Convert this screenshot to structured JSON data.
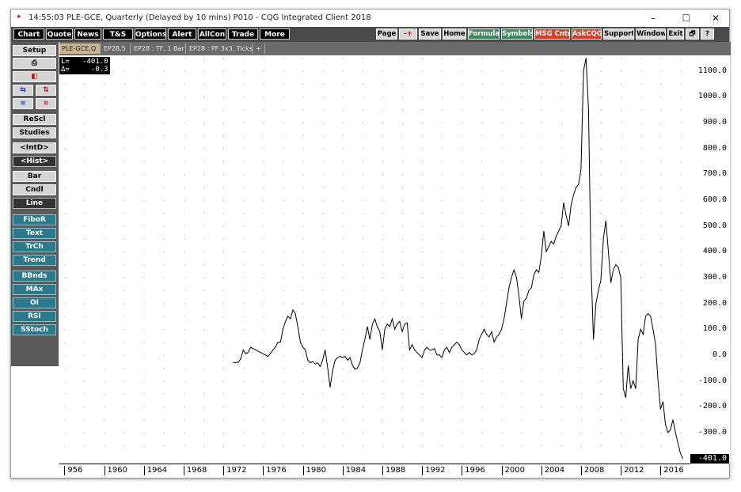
{
  "window": {
    "title": "14:55:03  PLE-GCE, Quarterly (Delayed by 10 mins)  P010 - CQG Integrated Client 2018",
    "minimize": "–",
    "maximize": "☐",
    "close": "✕"
  },
  "menu_left": [
    "Chart",
    "Quote",
    "News",
    "T&S",
    "Options",
    "Alert",
    "AllCon",
    "Trade",
    "More"
  ],
  "menu_right": [
    "Page",
    "-+",
    "Save",
    "Home",
    "Formula",
    "Symbols",
    "MSG Cntr",
    "AskCQG",
    "Support",
    "Window",
    "Exit",
    "🗗",
    "?"
  ],
  "tabs": [
    "Setup",
    "PLE-GCE,Q",
    "EP28,5",
    "EP28 : TF, 1 Bar",
    "EP28 : PF 3x3, Ticks",
    "+"
  ],
  "sidebar": {
    "print_icon": "printer-icon",
    "items": [
      "ReScl",
      "Studies",
      "<IntD>",
      "<Hist>",
      "Bar",
      "Cndl",
      "Line",
      "FiboR",
      "Text",
      "TrCh",
      "Trend",
      "BBnds",
      "MAx",
      "OI",
      "RSI",
      "SStoch"
    ]
  },
  "info_box": {
    "line1": "L=   -401.0",
    "line2": "Δ=     -0.3"
  },
  "last_value": "-401.0",
  "chart_data": {
    "type": "line",
    "title": "",
    "xlabel": "",
    "ylabel": "",
    "x_tick_labels": [
      "956",
      "1960",
      "1964",
      "1968",
      "1972",
      "1976",
      "1980",
      "1984",
      "1988",
      "1992",
      "1996",
      "2000",
      "2004",
      "2008",
      "2012",
      "2016"
    ],
    "y_tick_labels": [
      "1100.0",
      "1000.0",
      "900.0",
      "800.0",
      "700.0",
      "600.0",
      "500.0",
      "400.0",
      "300.0",
      "200.0",
      "100.0",
      "0.0",
      "-100.0",
      "-200.0",
      "-300.0"
    ],
    "ylim": [
      -420,
      1160
    ],
    "xlim": [
      1955.5,
      2019.0
    ],
    "grid": true,
    "series": [
      {
        "color": "#000000",
        "points": [
          [
            1973.0,
            -30
          ],
          [
            1973.5,
            -28
          ],
          [
            1973.75,
            -15
          ],
          [
            1974.0,
            20
          ],
          [
            1974.25,
            5
          ],
          [
            1974.5,
            10
          ],
          [
            1974.75,
            30
          ],
          [
            1975.0,
            25
          ],
          [
            1975.5,
            15
          ],
          [
            1976.0,
            5
          ],
          [
            1976.5,
            -5
          ],
          [
            1977.0,
            20
          ],
          [
            1977.25,
            30
          ],
          [
            1977.5,
            50
          ],
          [
            1977.75,
            50
          ],
          [
            1978.0,
            100
          ],
          [
            1978.25,
            130
          ],
          [
            1978.5,
            150
          ],
          [
            1978.75,
            140
          ],
          [
            1979.0,
            175
          ],
          [
            1979.25,
            160
          ],
          [
            1979.5,
            110
          ],
          [
            1979.75,
            50
          ],
          [
            1980.0,
            30
          ],
          [
            1980.25,
            20
          ],
          [
            1980.5,
            -20
          ],
          [
            1980.75,
            -30
          ],
          [
            1981.0,
            -25
          ],
          [
            1981.25,
            -35
          ],
          [
            1981.5,
            -30
          ],
          [
            1981.75,
            -45
          ],
          [
            1982.0,
            -20
          ],
          [
            1982.25,
            20
          ],
          [
            1982.5,
            -50
          ],
          [
            1982.75,
            -125
          ],
          [
            1983.0,
            -60
          ],
          [
            1983.25,
            -20
          ],
          [
            1983.5,
            -10
          ],
          [
            1983.75,
            -5
          ],
          [
            1984.0,
            -10
          ],
          [
            1984.25,
            -5
          ],
          [
            1984.5,
            -20
          ],
          [
            1984.75,
            -10
          ],
          [
            1985.0,
            -40
          ],
          [
            1985.25,
            -55
          ],
          [
            1985.5,
            -50
          ],
          [
            1985.75,
            -30
          ],
          [
            1986.0,
            20
          ],
          [
            1986.25,
            60
          ],
          [
            1986.5,
            110
          ],
          [
            1986.75,
            60
          ],
          [
            1987.0,
            120
          ],
          [
            1987.25,
            140
          ],
          [
            1987.5,
            110
          ],
          [
            1987.75,
            90
          ],
          [
            1988.0,
            20
          ],
          [
            1988.25,
            100
          ],
          [
            1988.5,
            120
          ],
          [
            1988.75,
            110
          ],
          [
            1989.0,
            140
          ],
          [
            1989.25,
            100
          ],
          [
            1989.5,
            120
          ],
          [
            1989.75,
            130
          ],
          [
            1990.0,
            90
          ],
          [
            1990.25,
            120
          ],
          [
            1990.5,
            125
          ],
          [
            1990.75,
            20
          ],
          [
            1991.0,
            40
          ],
          [
            1991.25,
            20
          ],
          [
            1991.5,
            10
          ],
          [
            1991.75,
            0
          ],
          [
            1992.0,
            -10
          ],
          [
            1992.25,
            20
          ],
          [
            1992.5,
            30
          ],
          [
            1992.75,
            20
          ],
          [
            1993.0,
            20
          ],
          [
            1993.25,
            25
          ],
          [
            1993.5,
            0
          ],
          [
            1993.75,
            0
          ],
          [
            1994.0,
            -10
          ],
          [
            1994.25,
            20
          ],
          [
            1994.5,
            30
          ],
          [
            1994.75,
            10
          ],
          [
            1995.0,
            30
          ],
          [
            1995.25,
            40
          ],
          [
            1995.5,
            50
          ],
          [
            1995.75,
            40
          ],
          [
            1996.0,
            20
          ],
          [
            1996.25,
            10
          ],
          [
            1996.5,
            0
          ],
          [
            1996.75,
            10
          ],
          [
            1997.0,
            0
          ],
          [
            1997.25,
            5
          ],
          [
            1997.5,
            20
          ],
          [
            1997.75,
            60
          ],
          [
            1998.0,
            80
          ],
          [
            1998.25,
            100
          ],
          [
            1998.5,
            80
          ],
          [
            1998.75,
            70
          ],
          [
            1999.0,
            90
          ],
          [
            1999.25,
            50
          ],
          [
            1999.5,
            70
          ],
          [
            1999.75,
            80
          ],
          [
            2000.0,
            100
          ],
          [
            2000.25,
            140
          ],
          [
            2000.5,
            200
          ],
          [
            2000.75,
            260
          ],
          [
            2001.0,
            300
          ],
          [
            2001.25,
            330
          ],
          [
            2001.5,
            300
          ],
          [
            2001.75,
            230
          ],
          [
            2002.0,
            140
          ],
          [
            2002.25,
            210
          ],
          [
            2002.5,
            220
          ],
          [
            2002.75,
            250
          ],
          [
            2003.0,
            260
          ],
          [
            2003.25,
            310
          ],
          [
            2003.5,
            330
          ],
          [
            2003.75,
            320
          ],
          [
            2004.0,
            380
          ],
          [
            2004.25,
            480
          ],
          [
            2004.5,
            400
          ],
          [
            2004.75,
            420
          ],
          [
            2005.0,
            440
          ],
          [
            2005.25,
            430
          ],
          [
            2005.5,
            460
          ],
          [
            2005.75,
            480
          ],
          [
            2006.0,
            500
          ],
          [
            2006.25,
            590
          ],
          [
            2006.5,
            540
          ],
          [
            2006.75,
            500
          ],
          [
            2007.0,
            580
          ],
          [
            2007.25,
            620
          ],
          [
            2007.5,
            650
          ],
          [
            2007.75,
            660
          ],
          [
            2008.0,
            720
          ],
          [
            2008.25,
            1100
          ],
          [
            2008.5,
            1150
          ],
          [
            2008.75,
            950
          ],
          [
            2009.0,
            350
          ],
          [
            2009.25,
            60
          ],
          [
            2009.5,
            200
          ],
          [
            2009.75,
            250
          ],
          [
            2010.0,
            290
          ],
          [
            2010.25,
            450
          ],
          [
            2010.5,
            520
          ],
          [
            2010.75,
            400
          ],
          [
            2011.0,
            280
          ],
          [
            2011.25,
            330
          ],
          [
            2011.5,
            350
          ],
          [
            2011.75,
            340
          ],
          [
            2012.0,
            300
          ],
          [
            2012.25,
            -130
          ],
          [
            2012.5,
            -165
          ],
          [
            2012.75,
            -40
          ],
          [
            2013.0,
            -130
          ],
          [
            2013.25,
            -100
          ],
          [
            2013.5,
            -130
          ],
          [
            2013.75,
            60
          ],
          [
            2014.0,
            100
          ],
          [
            2014.25,
            80
          ],
          [
            2014.5,
            150
          ],
          [
            2014.75,
            160
          ],
          [
            2015.0,
            150
          ],
          [
            2015.25,
            100
          ],
          [
            2015.5,
            40
          ],
          [
            2015.75,
            -100
          ],
          [
            2016.0,
            -210
          ],
          [
            2016.25,
            -180
          ],
          [
            2016.5,
            -270
          ],
          [
            2016.75,
            -300
          ],
          [
            2017.0,
            -290
          ],
          [
            2017.25,
            -250
          ],
          [
            2017.5,
            -300
          ],
          [
            2017.75,
            -340
          ],
          [
            2018.0,
            -380
          ],
          [
            2018.25,
            -401
          ]
        ]
      }
    ]
  }
}
